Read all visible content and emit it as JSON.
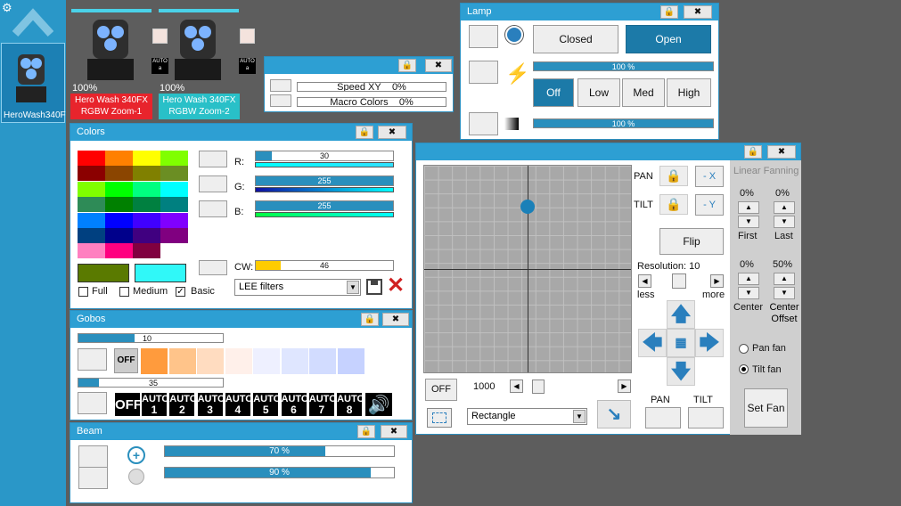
{
  "sidebar": {
    "fixture_label": "HeroWash340F"
  },
  "fixtures": [
    {
      "percent": "100%",
      "name_line1": "Hero Wash 340FX",
      "name_line2": "RGBW Zoom-1",
      "auto": "AUTO",
      "color": "#e8242c"
    },
    {
      "percent": "100%",
      "name_line1": "Hero Wash 340FX",
      "name_line2": "RGBW Zoom-2",
      "auto": "AUTO",
      "color": "#29c0c8"
    }
  ],
  "speed": {
    "speed_label": "Speed XY",
    "speed_value": "0%",
    "macro_label": "Macro Colors",
    "macro_value": "0%"
  },
  "lamp": {
    "title": "Lamp",
    "closed": "Closed",
    "open": "Open",
    "bar1": "100 %",
    "off": "Off",
    "low": "Low",
    "med": "Med",
    "high": "High",
    "bar2": "100 %",
    "bar1_level": 1.0,
    "bar2_level": 1.0
  },
  "colors": {
    "title": "Colors",
    "r_label": "R:",
    "g_label": "G:",
    "b_label": "B:",
    "cw_label": "CW:",
    "r_value": "30",
    "g_value": "255",
    "b_value": "255",
    "cw_value": "46",
    "r_level": 0.118,
    "g_level": 1.0,
    "b_level": 1.0,
    "cw_level": 0.18,
    "swatches": [
      "#ff0000",
      "#ff8000",
      "#ffff00",
      "#80ff00",
      "#8b0000",
      "#8b4500",
      "#808000",
      "#6b8e23",
      "#80ff00",
      "#00ff00",
      "#00ff80",
      "#00ffff",
      "#2e8b57",
      "#008000",
      "#008040",
      "#008080",
      "#0080ff",
      "#0000ff",
      "#4000ff",
      "#8000ff",
      "#004080",
      "#00008b",
      "#400080",
      "#800080",
      "#ff80c0",
      "#ff0080",
      "#800040",
      "#ffffff"
    ],
    "selected1": "#5a7a00",
    "selected2": "#30f8f8",
    "full": "Full",
    "medium": "Medium",
    "basic": "Basic",
    "filter": "LEE filters"
  },
  "gobos": {
    "title": "Gobos",
    "bar1": "10",
    "bar2": "35",
    "bar1_level": 0.39,
    "bar2_level": 0.14,
    "off": "OFF",
    "swatches": [
      "#ff9b3d",
      "#ffc48a",
      "#ffdcc0",
      "#fff0ea",
      "#eef0ff",
      "#dfe6ff",
      "#d2dcff",
      "#c6d2ff"
    ],
    "autos": [
      "1",
      "2",
      "3",
      "4",
      "5",
      "6",
      "7",
      "8"
    ],
    "auto_label": "AUTO"
  },
  "beam": {
    "title": "Beam",
    "zoom": "70 %",
    "focus": "90 %",
    "zoom_level": 0.7,
    "focus_level": 0.9
  },
  "xy": {
    "off": "OFF",
    "value": "1000",
    "mode": "Rectangle",
    "dot_x": 0.5,
    "dot_y": 0.2,
    "pan": "PAN",
    "tilt": "TILT",
    "pan_btn": "- X",
    "tilt_btn": "- Y",
    "flip": "Flip",
    "resolution": "Resolution: 10",
    "less": "less",
    "more": "more",
    "pan2": "PAN",
    "tilt2": "TILT"
  },
  "fanning": {
    "title": "Linear Fanning",
    "first_val": "0%",
    "last_val": "0%",
    "first": "First",
    "last": "Last",
    "center_val": "0%",
    "offset_val": "50%",
    "center": "Center",
    "offset": "Center Offset",
    "pan_fan": "Pan fan",
    "tilt_fan": "Tilt fan",
    "set_fan": "Set Fan"
  }
}
